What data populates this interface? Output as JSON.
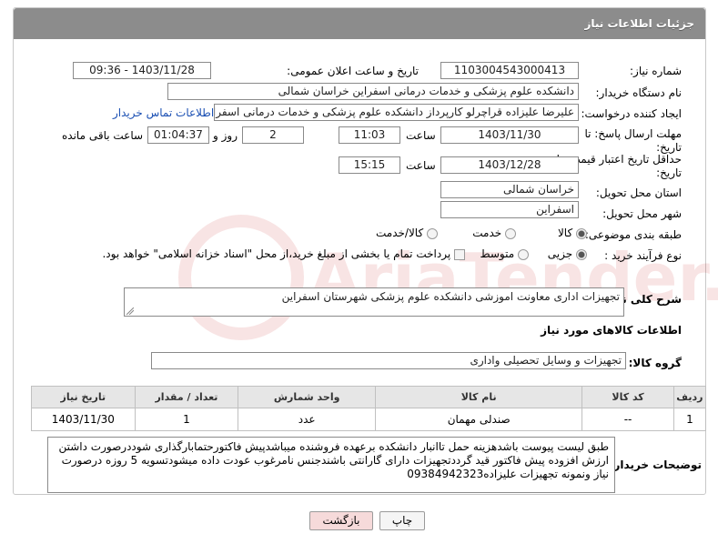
{
  "header": {
    "title": "جزئیات اطلاعات نیاز"
  },
  "form": {
    "need_number_label": "شماره نیاز:",
    "need_number": "1103004543000413",
    "announce_label": "تاریخ و ساعت اعلان عمومی:",
    "announce_value": "1403/11/28 - 09:36",
    "buyer_org_label": "نام دستگاه خریدار:",
    "buyer_org": "دانشکده علوم پزشکی و خدمات درمانی اسفراین خراسان شمالی",
    "creator_label": "ایجاد کننده درخواست:",
    "creator": "علیرضا علیزاده قراچرلو کارپرداز  دانشکده علوم پزشکی و خدمات درمانی اسفراین",
    "contact_link": "اطلاعات تماس خریدار",
    "deadline_label_1": "مهلت ارسال پاسخ: تا",
    "deadline_label_2": "تاریخ:",
    "deadline_date": "1403/11/30",
    "time_label": "ساعت",
    "deadline_time": "11:03",
    "days_value": "2",
    "days_label": "روز و",
    "remaining_time": "01:04:37",
    "remaining_label": "ساعت باقی مانده",
    "validity_label_1": "حداقل تاریخ اعتبار قیمت: تا",
    "validity_label_2": "تاریخ:",
    "validity_date": "1403/12/28",
    "validity_time": "15:15",
    "province_label": "استان محل تحویل:",
    "province": "خراسان شمالی",
    "city_label": "شهر محل تحویل:",
    "city": "اسفراین",
    "category_label": "طبقه بندی موضوعی:",
    "category_options": [
      "کالا",
      "خدمت",
      "کالا/خدمت"
    ],
    "process_label": "نوع فرآیند خرید :",
    "process_options": [
      "جزیی",
      "متوسط"
    ],
    "payment_note": "پرداخت تمام یا بخشی از مبلغ خرید،از محل \"اسناد خزانه اسلامی\" خواهد بود."
  },
  "summary": {
    "label": "شرح کلی نیاز:",
    "value": "تجهیزات اداری معاونت اموزشی دانشکده علوم پزشکی شهرستان اسفراین"
  },
  "goods_section": {
    "title": "اطلاعات کالاهای مورد نیاز",
    "group_label": "گروه کالا:",
    "group_value": "تجهیزات و وسایل تحصیلی واداری"
  },
  "table": {
    "headers": [
      "ردیف",
      "کد کالا",
      "نام کالا",
      "واحد شمارش",
      "تعداد / مقدار",
      "تاریخ نیاز"
    ],
    "rows": [
      [
        "1",
        "--",
        "صندلی مهمان",
        "عدد",
        "1",
        "1403/11/30"
      ]
    ]
  },
  "buyer_notes": {
    "label": "توضیحات خریدار:",
    "text": "طبق لیست پیوست باشدهزینه حمل تاانبار دانشکده برعهده فروشنده میباشدپیش فاکتورحتمابارگذاری شوددرصورت داشتن ارزش افزوده پیش فاکتور قید گرددتجهیزات دارای گارانتی باشندجنس نامرغوب عودت داده میشودتسویه 5 روزه درصورت نیاز ونمونه تجهیزات علیزاده09384942323"
  },
  "buttons": {
    "print": "چاپ",
    "back": "بازگشت"
  },
  "watermark_text": "AriaTender.net",
  "colors": {
    "titlebar": "#8c8c8c",
    "link": "#1a4fb3",
    "back_button": "#f6dada",
    "watermark": "#c00000"
  }
}
